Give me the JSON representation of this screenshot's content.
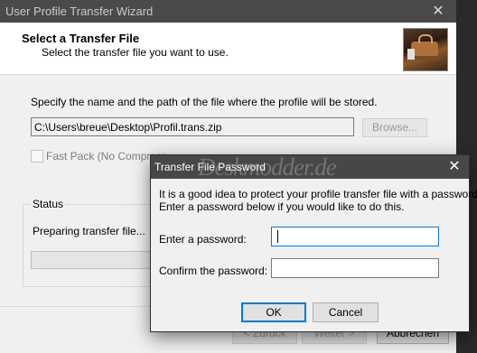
{
  "wizard": {
    "title": "User Profile Transfer Wizard",
    "close_glyph": "✕",
    "header_title": "Select a Transfer File",
    "header_subtitle": "Select the transfer file you want to use.",
    "instruction": "Specify the name and the path of the file where the profile will be stored.",
    "path_value": "C:\\Users\\breue\\Desktop\\Profil.trans.zip",
    "browse_label": "Browse...",
    "fast_pack_label": "Fast Pack (No Compress",
    "fast_pack_checked": false,
    "status_group_label": "Status",
    "status_text": "Preparing transfer file...",
    "back_label": "< Zurück",
    "next_label": "Weiter >",
    "cancel_label": "Abbrechen"
  },
  "dialog": {
    "title": "Transfer File Password",
    "close_glyph": "✕",
    "watermark": "Deskmodder.de",
    "message_line1": "It is a good idea to protect your profile transfer file with a password.",
    "message_line2": "Enter a password below if you would like to do this.",
    "password_label": "Enter a password:",
    "confirm_label": "Confirm the password:",
    "password_value": "",
    "confirm_value": "",
    "ok_label": "OK",
    "cancel_label": "Cancel"
  },
  "colors": {
    "titlebar": "#4a4a4a",
    "focus_accent": "#0078d7",
    "window_bg": "#f0f0f0"
  }
}
